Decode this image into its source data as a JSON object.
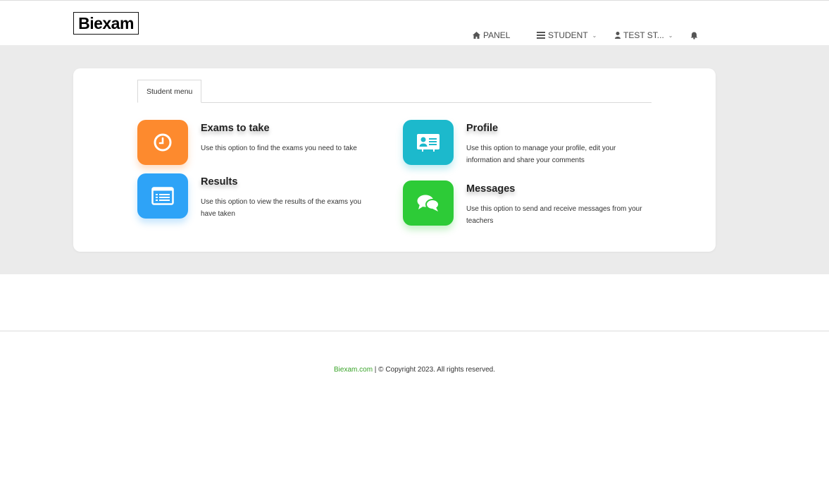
{
  "brand": {
    "logo_text": "Biexam"
  },
  "nav": {
    "panel": "PANEL",
    "student": "STUDENT",
    "user": "TEST ST...",
    "icons": {
      "panel": "home-icon",
      "student": "list-icon",
      "user": "user-icon",
      "notifications": "bell-icon"
    }
  },
  "tabs": [
    {
      "label": "Student menu",
      "active": true
    }
  ],
  "menu": {
    "exams": {
      "title": "Exams to take",
      "description": "Use this option to find the exams you need to take",
      "color": "#fd8a2e",
      "icon": "clock-icon"
    },
    "results": {
      "title": "Results",
      "description": "Use this option to view the results of the exams you have taken",
      "color": "#2ea3f7",
      "icon": "list-window-icon"
    },
    "profile": {
      "title": "Profile",
      "description": "Use this option to manage your profile, edit your information and share your comments",
      "color": "#1cb9cc",
      "icon": "id-card-icon"
    },
    "messages": {
      "title": "Messages",
      "description": "Use this option to send and receive messages from your teachers",
      "color": "#2dcb37",
      "icon": "chat-bubbles-icon"
    }
  },
  "footer": {
    "site_link": "Biexam.com",
    "copyright": " | © Copyright  2023.  All rights reserved.",
    "link_color": "#3aa42a"
  }
}
